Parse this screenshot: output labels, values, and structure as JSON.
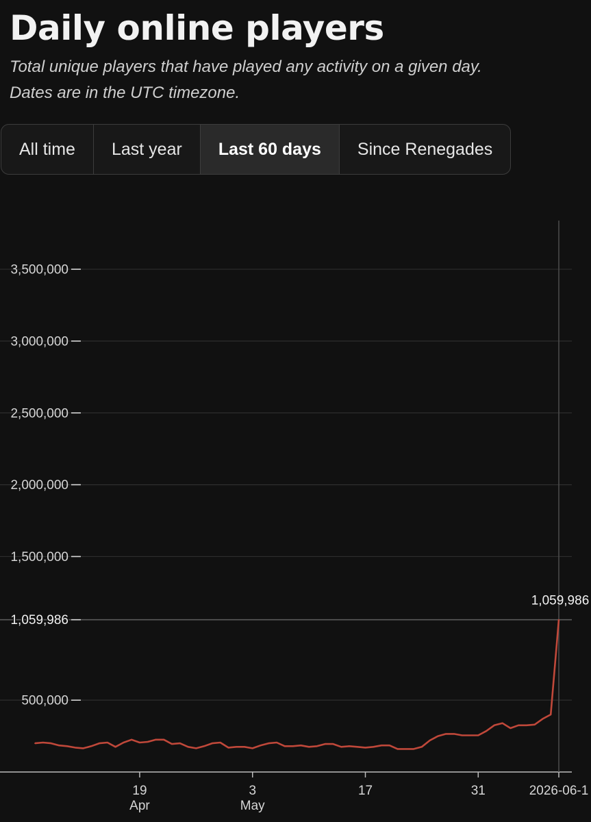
{
  "header": {
    "title": "Daily online players",
    "subtitle_line1": "Total unique players that have played any activity on a given day.",
    "subtitle_line2": "Dates are in the UTC timezone."
  },
  "range_tabs": [
    {
      "label": "All time",
      "active": false
    },
    {
      "label": "Last year",
      "active": false
    },
    {
      "label": "Last 60 days",
      "active": true
    },
    {
      "label": "Since Renegades",
      "active": false
    }
  ],
  "chart_data": {
    "type": "line",
    "title": "",
    "xlabel": "",
    "ylabel": "",
    "ylim": [
      0,
      3800000
    ],
    "grid": true,
    "line_color": "#c0483a",
    "y_ticks": [
      {
        "value": 3500000,
        "label": "3,500,000"
      },
      {
        "value": 3000000,
        "label": "3,000,000"
      },
      {
        "value": 2500000,
        "label": "2,500,000"
      },
      {
        "value": 2000000,
        "label": "2,000,000"
      },
      {
        "value": 1500000,
        "label": "1,500,000"
      },
      {
        "value": 1059986,
        "label": "1,059,986"
      },
      {
        "value": 500000,
        "label": "500,000"
      }
    ],
    "x_ticks": [
      {
        "date": "2026-04-19",
        "label": "19",
        "sublabel": "Apr"
      },
      {
        "date": "2026-05-03",
        "label": "3",
        "sublabel": "May"
      },
      {
        "date": "2026-05-17",
        "label": "17",
        "sublabel": ""
      },
      {
        "date": "2026-05-31",
        "label": "31",
        "sublabel": ""
      },
      {
        "date": "2026-06-10",
        "label": "2026-06-1",
        "sublabel": ""
      }
    ],
    "highlight": {
      "date": "2026-06-10",
      "value": 1059986,
      "label": "1,059,986"
    },
    "series": [
      {
        "x": [
          "2026-04-06",
          "2026-04-07",
          "2026-04-08",
          "2026-04-09",
          "2026-04-10",
          "2026-04-11",
          "2026-04-12",
          "2026-04-13",
          "2026-04-14",
          "2026-04-15",
          "2026-04-16",
          "2026-04-17",
          "2026-04-18",
          "2026-04-19",
          "2026-04-20",
          "2026-04-21",
          "2026-04-22",
          "2026-04-23",
          "2026-04-24",
          "2026-04-25",
          "2026-04-26",
          "2026-04-27",
          "2026-04-28",
          "2026-04-29",
          "2026-04-30",
          "2026-05-01",
          "2026-05-02",
          "2026-05-03",
          "2026-05-04",
          "2026-05-05",
          "2026-05-06",
          "2026-05-07",
          "2026-05-08",
          "2026-05-09",
          "2026-05-10",
          "2026-05-11",
          "2026-05-12",
          "2026-05-13",
          "2026-05-14",
          "2026-05-15",
          "2026-05-16",
          "2026-05-17",
          "2026-05-18",
          "2026-05-19",
          "2026-05-20",
          "2026-05-21",
          "2026-05-22",
          "2026-05-23",
          "2026-05-24",
          "2026-05-25",
          "2026-05-26",
          "2026-05-27",
          "2026-05-28",
          "2026-05-29",
          "2026-05-30",
          "2026-05-31",
          "2026-06-01",
          "2026-06-02",
          "2026-06-03",
          "2026-06-04",
          "2026-06-05",
          "2026-06-06",
          "2026-06-07",
          "2026-06-08",
          "2026-06-09",
          "2026-06-10"
        ],
        "values": [
          200000,
          205000,
          200000,
          185000,
          180000,
          170000,
          165000,
          180000,
          200000,
          205000,
          175000,
          205000,
          225000,
          205000,
          210000,
          225000,
          225000,
          195000,
          200000,
          175000,
          165000,
          180000,
          200000,
          205000,
          170000,
          175000,
          175000,
          165000,
          185000,
          200000,
          205000,
          180000,
          180000,
          185000,
          175000,
          180000,
          195000,
          195000,
          175000,
          180000,
          175000,
          170000,
          175000,
          185000,
          185000,
          160000,
          160000,
          160000,
          175000,
          220000,
          250000,
          265000,
          265000,
          255000,
          255000,
          255000,
          285000,
          325000,
          340000,
          305000,
          325000,
          325000,
          330000,
          370000,
          400000,
          1059986
        ]
      }
    ]
  }
}
